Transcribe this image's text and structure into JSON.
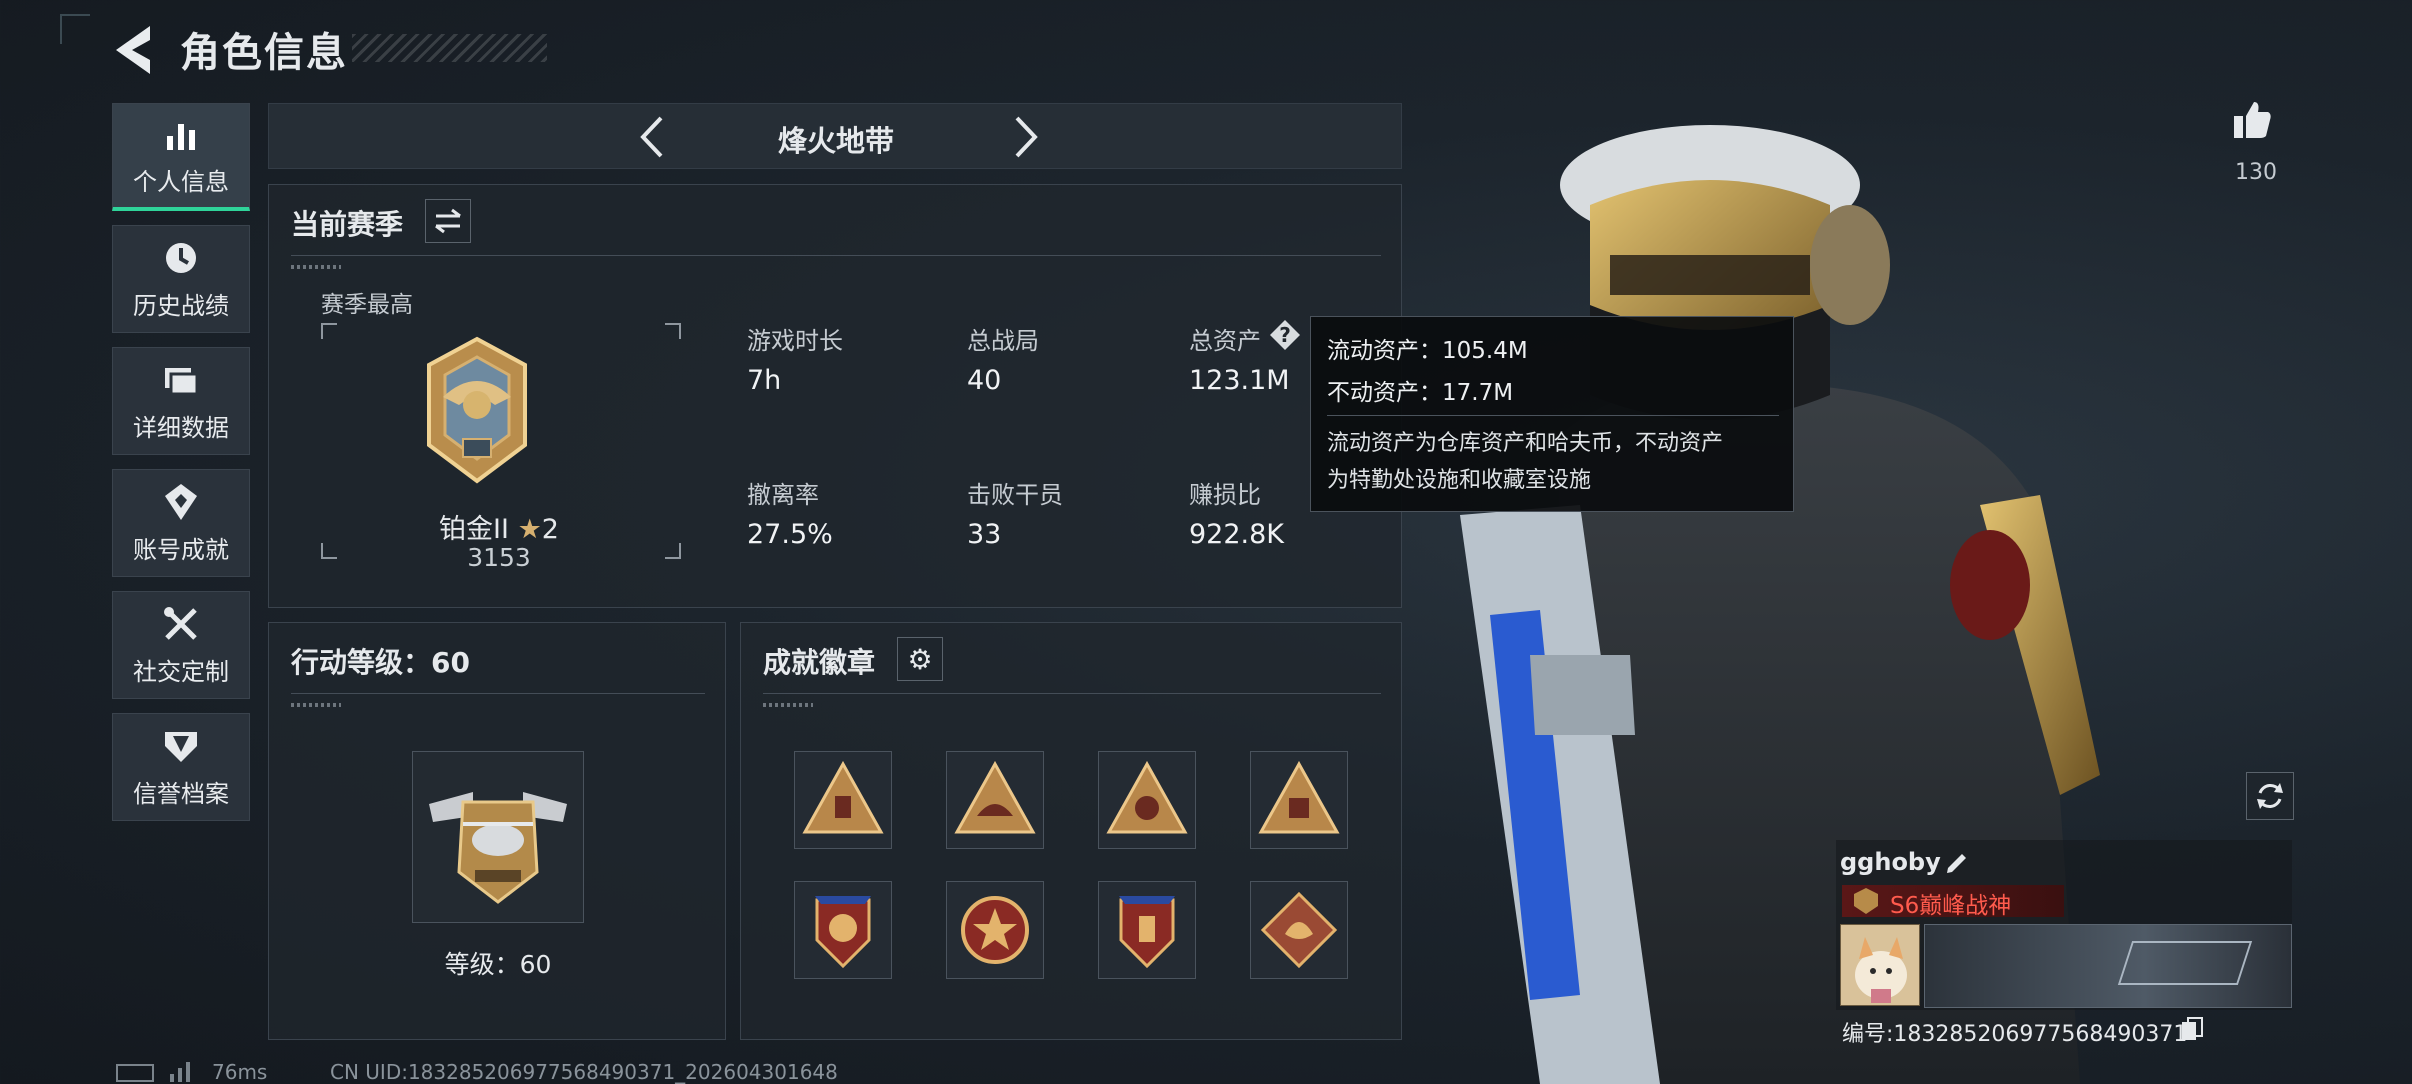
{
  "header": {
    "title": "角色信息"
  },
  "sidebar": {
    "items": [
      {
        "label": "个人信息",
        "icon": "bar-chart-icon",
        "active": true
      },
      {
        "label": "历史战绩",
        "icon": "history-icon",
        "active": false
      },
      {
        "label": "详细数据",
        "icon": "folder-icon",
        "active": false
      },
      {
        "label": "账号成就",
        "icon": "achievement-icon",
        "active": false
      },
      {
        "label": "社交定制",
        "icon": "tools-icon",
        "active": false
      },
      {
        "label": "信誉档案",
        "icon": "shield-icon",
        "active": false
      }
    ]
  },
  "mode": {
    "name": "烽火地带"
  },
  "season": {
    "title": "当前赛季",
    "best_label": "赛季最高",
    "rank_name": "铂金II",
    "rank_stars": "2",
    "rank_points": "3153",
    "stats": [
      {
        "label": "游戏时长",
        "value": "7h"
      },
      {
        "label": "总战局",
        "value": "40"
      },
      {
        "label": "总资产",
        "value": "123.1M"
      },
      {
        "label": "撤离率",
        "value": "27.5%"
      },
      {
        "label": "击败干员",
        "value": "33"
      },
      {
        "label": "赚损比",
        "value": "922.8K"
      }
    ]
  },
  "tooltip": {
    "line1": "流动资产：105.4M",
    "line2": "不动资产：17.7M",
    "desc1": "流动资产为仓库资产和哈夫币，不动资产",
    "desc2": "为特勤处设施和收藏室设施"
  },
  "action_level": {
    "title": "行动等级：60",
    "level_text": "等级：60"
  },
  "badges": {
    "title": "成就徽章",
    "items": [
      "badge-1",
      "badge-2",
      "badge-3",
      "badge-4",
      "badge-5",
      "badge-6",
      "badge-7",
      "badge-8"
    ]
  },
  "profile": {
    "name": "gghoby",
    "title": "S6巅峰战神",
    "uid_label": "编号:1832852069775684903​71",
    "likes": "130"
  },
  "status": {
    "ping": "76ms",
    "uid_line": "CN UID:18328520697756849037​1_202604301648"
  },
  "colors": {
    "accent": "#2fd49a",
    "title_red": "#ff5b4d",
    "bg": "#1c242c"
  }
}
